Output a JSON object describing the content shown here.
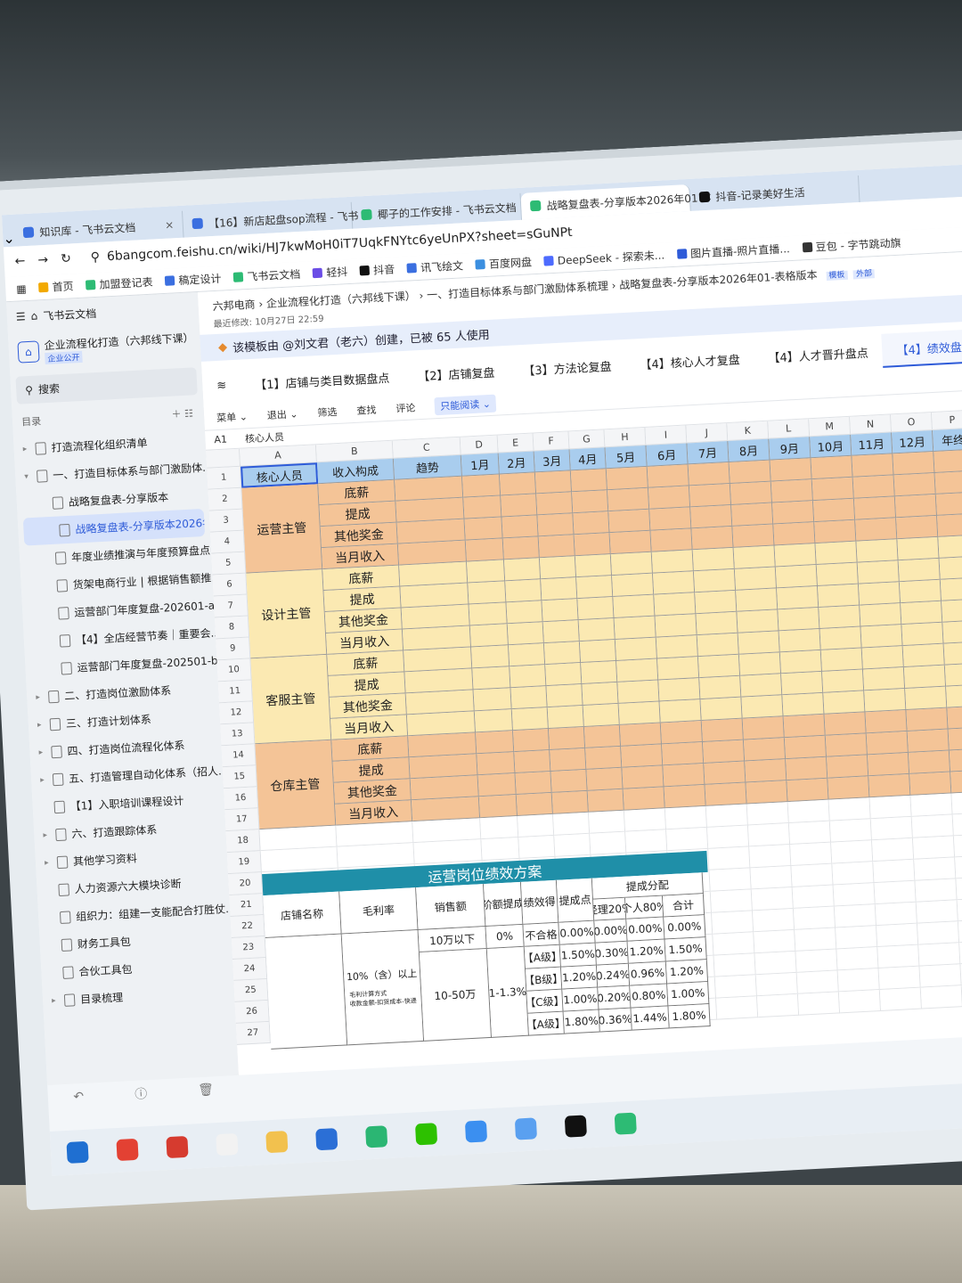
{
  "browser": {
    "tabs": [
      {
        "label": "知识库 - 飞书云文档",
        "close": "×",
        "color": "#3b6fe0"
      },
      {
        "label": "【16】新店起盘sop流程 - 飞书",
        "close": "×",
        "color": "#3b6fe0"
      },
      {
        "label": "椰子的工作安排 - 飞书云文档",
        "close": "×",
        "color": "#2dbb74"
      },
      {
        "label": "战略复盘表-分享版本2026年01",
        "close": "×",
        "color": "#2dbb74"
      },
      {
        "label": "抖音-记录美好生活",
        "close": "",
        "color": "#111111"
      }
    ],
    "url": "6bangcom.feishu.cn/wiki/HJ7kwMoH0iT7UqkFNYtc6yeUnPX?sheet=sGuNPt",
    "bookmarks": [
      {
        "label": "首页",
        "color": "#f2a900"
      },
      {
        "label": "加盟登记表",
        "color": "#2dbb74"
      },
      {
        "label": "稿定设计",
        "color": "#3b6fe0"
      },
      {
        "label": "飞书云文档",
        "color": "#2dbb74"
      },
      {
        "label": "轻抖",
        "color": "#6b4de6"
      },
      {
        "label": "抖音",
        "color": "#111111"
      },
      {
        "label": "讯飞绘文",
        "color": "#3b6fe0"
      },
      {
        "label": "百度网盘",
        "color": "#3b8fe0"
      },
      {
        "label": "DeepSeek - 探索未...",
        "color": "#4d6bfe"
      },
      {
        "label": "图片直播-照片直播...",
        "color": "#2e5bd8"
      },
      {
        "label": "豆包 - 字节跳动旗",
        "color": "#333333"
      }
    ]
  },
  "sidebar": {
    "header": "飞书云文档",
    "space_name": "企业流程化打造（六邦线下课）",
    "space_tag": "企业公开",
    "search": "搜索",
    "toc_label": "目录",
    "items": [
      {
        "label": "打造流程化组织清单",
        "indent": 0,
        "arrow": "▸"
      },
      {
        "label": "一、打造目标体系与部门激励体...",
        "indent": 0,
        "arrow": "▾"
      },
      {
        "label": "战略复盘表-分享版本",
        "indent": 1,
        "arrow": ""
      },
      {
        "label": "战略复盘表-分享版本2026年0...",
        "indent": 1,
        "arrow": "",
        "selected": true
      },
      {
        "label": "年度业绩推演与年度预算盘点",
        "indent": 1,
        "arrow": ""
      },
      {
        "label": "货架电商行业 | 根据销售额推...",
        "indent": 1,
        "arrow": ""
      },
      {
        "label": "运营部门年度复盘-202601-a...",
        "indent": 1,
        "arrow": ""
      },
      {
        "label": "【4】全店经营节奏｜重要会...",
        "indent": 1,
        "arrow": ""
      },
      {
        "label": "运营部门年度复盘-202501-b...",
        "indent": 1,
        "arrow": ""
      },
      {
        "label": "二、打造岗位激励体系",
        "indent": 0,
        "arrow": "▸"
      },
      {
        "label": "三、打造计划体系",
        "indent": 0,
        "arrow": "▸"
      },
      {
        "label": "四、打造岗位流程化体系",
        "indent": 0,
        "arrow": "▸"
      },
      {
        "label": "五、打造管理自动化体系（招人...",
        "indent": 0,
        "arrow": "▸"
      },
      {
        "label": "【1】入职培训课程设计",
        "indent": 0,
        "arrow": ""
      },
      {
        "label": "六、打造跟踪体系",
        "indent": 0,
        "arrow": "▸"
      },
      {
        "label": "其他学习资料",
        "indent": 0,
        "arrow": "▸"
      },
      {
        "label": "人力资源六大模块诊断",
        "indent": 0,
        "arrow": ""
      },
      {
        "label": "组织力：组建一支能配合打胜仗...",
        "indent": 0,
        "arrow": ""
      },
      {
        "label": "财务工具包",
        "indent": 0,
        "arrow": ""
      },
      {
        "label": "合伙工具包",
        "indent": 0,
        "arrow": ""
      },
      {
        "label": "目录梳理",
        "indent": 0,
        "arrow": "▸"
      }
    ]
  },
  "doc": {
    "breadcrumb": "六邦电商 › 企业流程化打造（六邦线下课） › 一、打造目标体系与部门激励体系梳理 › 战略复盘表-分享版本2026年01-表格版本",
    "badges": [
      "模板",
      "外部"
    ],
    "last_modified": "最近修改: 10月27日 22:59",
    "notice": "该模板由 @刘文君（老六）创建，已被 65 人使用",
    "sheet_tabs": [
      {
        "label": "【1】店铺与类目数据盘点"
      },
      {
        "label": "【2】店铺复盘"
      },
      {
        "label": "【3】方法论复盘"
      },
      {
        "label": "【4】核心人才复盘"
      },
      {
        "label": "【4】人才晋升盘点"
      },
      {
        "label": "【4】绩效盘点",
        "active": true
      }
    ],
    "toolbar": [
      "菜单 ⌄",
      "退出 ⌄",
      "筛选",
      "查找",
      "评论"
    ],
    "read_only": "只能阅读 ⌄",
    "cell_ref": "A1",
    "cell_value": "核心人员"
  },
  "sheet": {
    "col_letters": [
      "A",
      "B",
      "C",
      "D",
      "E",
      "F",
      "G",
      "H",
      "I",
      "J",
      "K",
      "L",
      "M",
      "N",
      "O",
      "P"
    ],
    "row_numbers": [
      "1",
      "2",
      "3",
      "4",
      "5",
      "6",
      "7",
      "8",
      "9",
      "10",
      "11",
      "12",
      "13",
      "14",
      "15",
      "16",
      "17",
      "18",
      "19",
      "20",
      "21",
      "22",
      "23",
      "24",
      "25",
      "26",
      "27"
    ],
    "header": [
      "核心人员",
      "收入构成",
      "趋势",
      "1月",
      "2月",
      "3月",
      "4月",
      "5月",
      "6月",
      "7月",
      "8月",
      "9月",
      "10月",
      "11月",
      "12月",
      "年终"
    ],
    "groups": [
      {
        "role": "运营主管",
        "color": "#f4c497",
        "items": [
          "底薪",
          "提成",
          "其他奖金",
          "当月收入"
        ]
      },
      {
        "role": "设计主管",
        "color": "#fbe9b2",
        "items": [
          "底薪",
          "提成",
          "其他奖金",
          "当月收入"
        ]
      },
      {
        "role": "客服主管",
        "color": "#fbe9b2",
        "items": [
          "底薪",
          "提成",
          "其他奖金",
          "当月收入"
        ]
      },
      {
        "role": "仓库主管",
        "color": "#f4c497",
        "items": [
          "底薪",
          "提成",
          "其他奖金",
          "当月收入"
        ]
      }
    ],
    "header_color": "#a9cdee"
  },
  "plan": {
    "title": "运营岗位绩效方案",
    "title_color": "#1f8fa8",
    "headers": [
      "店铺名称",
      "毛利率",
      "销售额",
      "阶额提成",
      "绩效得",
      "提成点",
      "提成分配"
    ],
    "sub_headers": [
      "经理20%",
      "个人80%",
      "合计"
    ],
    "margin_label": "10%（含）以上",
    "footnote_lines": [
      "毛利计算方式",
      "收款金额-扣货成本-快递"
    ],
    "rows": [
      {
        "sales": "10万以下",
        "tier": "0%",
        "grade": "不合格",
        "point": "0.00%",
        "mgr": "0.00%",
        "ind": "0.00%",
        "sum": "0.00%"
      },
      {
        "sales": "",
        "tier": "",
        "grade": "【A级】",
        "point": "1.50%",
        "mgr": "0.30%",
        "ind": "1.20%",
        "sum": "1.50%"
      },
      {
        "sales": "10-50万",
        "tier": "1-1.3%",
        "grade": "【B级】",
        "point": "1.20%",
        "mgr": "0.24%",
        "ind": "0.96%",
        "sum": "1.20%"
      },
      {
        "sales": "",
        "tier": "",
        "grade": "【C级】",
        "point": "1.00%",
        "mgr": "0.20%",
        "ind": "0.80%",
        "sum": "1.00%"
      },
      {
        "sales": "",
        "tier": "",
        "grade": "【A级】",
        "point": "1.80%",
        "mgr": "0.36%",
        "ind": "1.44%",
        "sum": "1.80%"
      }
    ]
  },
  "taskbar": {
    "icons": [
      {
        "name": "windows-start-icon",
        "color": "#1f6fd1"
      },
      {
        "name": "chrome-icon",
        "color": "#e34133"
      },
      {
        "name": "wps-icon",
        "color": "#d63b2f"
      },
      {
        "name": "file-icon",
        "color": "#f2f2f2"
      },
      {
        "name": "folder-icon",
        "color": "#f2c14e"
      },
      {
        "name": "shield-icon",
        "color": "#2b6fd6"
      },
      {
        "name": "edge-icon",
        "color": "#2bb673"
      },
      {
        "name": "wechat-icon",
        "color": "#2dc100"
      },
      {
        "name": "feishu-icon",
        "color": "#3b8ff0"
      },
      {
        "name": "app-icon",
        "color": "#5aa0f0"
      },
      {
        "name": "capcut-icon",
        "color": "#111111"
      },
      {
        "name": "monitor-icon",
        "color": "#2dbb74"
      }
    ]
  }
}
